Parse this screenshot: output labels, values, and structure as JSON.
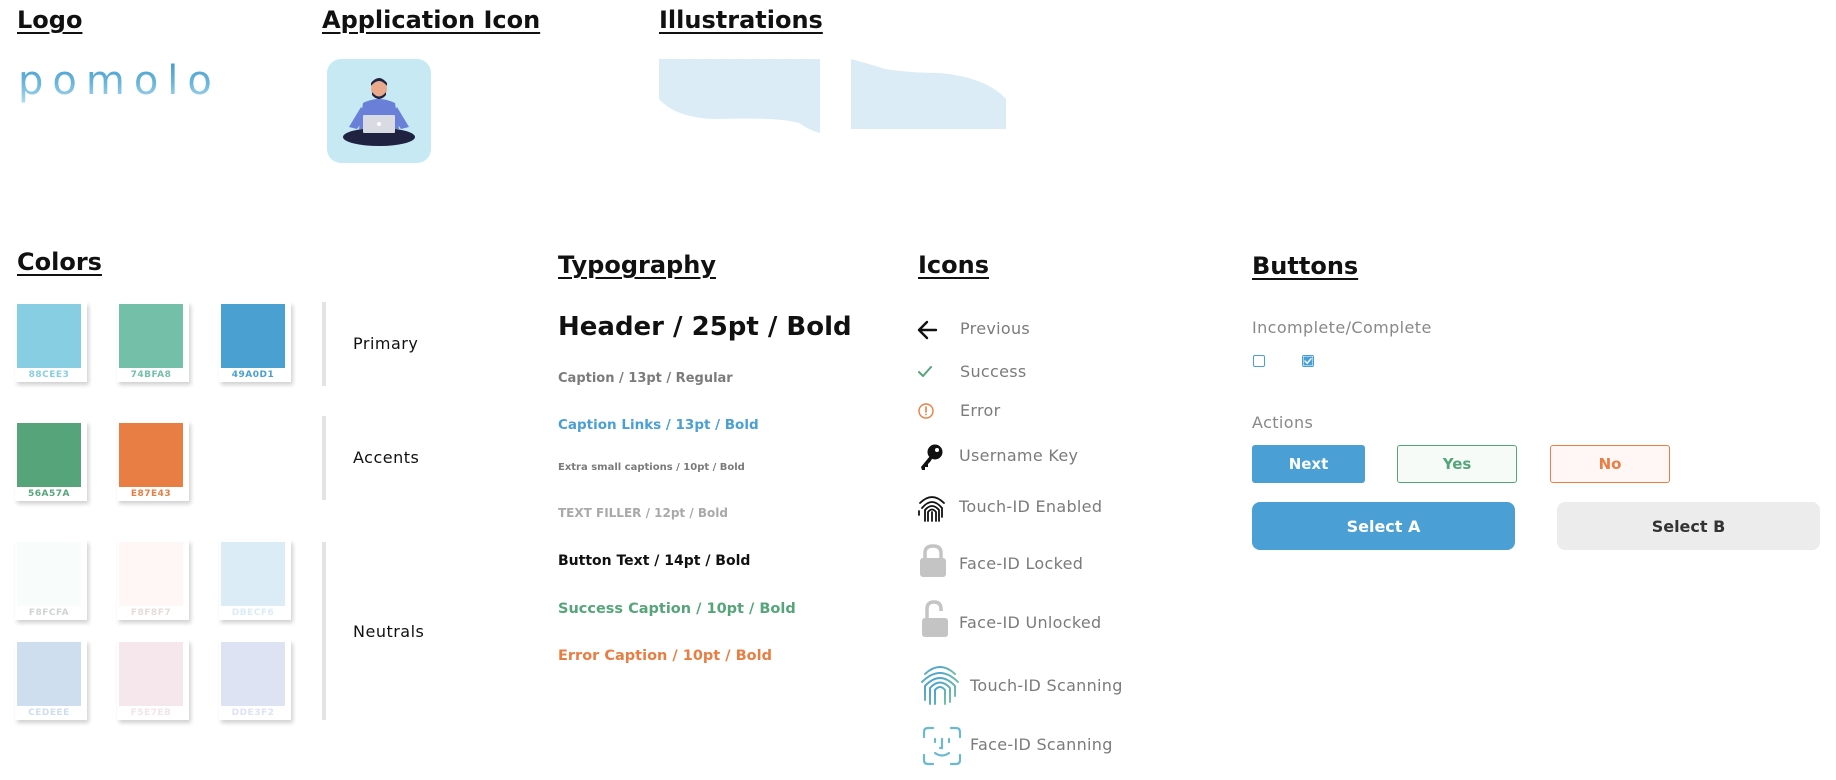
{
  "sections": {
    "logo": "Logo",
    "app_icon": "Application Icon",
    "illustrations": "Illustrations",
    "colors": "Colors",
    "typography": "Typography",
    "icons": "Icons",
    "buttons": "Buttons"
  },
  "logo": {
    "text": "pomolo"
  },
  "colors": {
    "groups": [
      {
        "label": "Primary"
      },
      {
        "label": "Accents"
      },
      {
        "label": "Neutrals"
      }
    ],
    "primary": [
      {
        "hex": "88CEE3",
        "color": "#88CEE3",
        "text_color": "#88CEE3"
      },
      {
        "hex": "74BFA8",
        "color": "#74BFA8",
        "text_color": "#74BFA8"
      },
      {
        "hex": "49A0D1",
        "color": "#49A0D1",
        "text_color": "#49A0D1"
      }
    ],
    "accents": [
      {
        "hex": "56A57A",
        "color": "#56A57A",
        "text_color": "#56A57A"
      },
      {
        "hex": "E87E43",
        "color": "#E87E43",
        "text_color": "#E87E43"
      }
    ],
    "neutrals": [
      {
        "hex": "F8FCFA",
        "color": "#F8FCFA",
        "text_color": "#d8dcda"
      },
      {
        "hex": "F8F8F7",
        "color": "#FEF7F5",
        "text_color": "#ece4e2"
      },
      {
        "hex": "DBECF6",
        "color": "#DBECF6",
        "text_color": "#dbecf6"
      },
      {
        "hex": "CEDEEE",
        "color": "#CEDEEE",
        "text_color": "#d6e6f2"
      },
      {
        "hex": "F5E7EB",
        "color": "#F5E7EB",
        "text_color": "#f1e5e8"
      },
      {
        "hex": "DDE3F2",
        "color": "#DDE3F2",
        "text_color": "#dfe4f2"
      }
    ]
  },
  "typography": {
    "header": "Header / 25pt / Bold",
    "caption": "Caption / 13pt / Regular",
    "caption_links": "Caption Links / 13pt / Bold",
    "extra_small": "Extra small captions / 10pt / Bold",
    "text_filler": "TEXT FILLER / 12pt / Bold",
    "button_text": "Button Text / 14pt / Bold",
    "success_caption": "Success Caption / 10pt / Bold",
    "error_caption": "Error Caption / 10pt / Bold"
  },
  "icons": {
    "previous": "Previous",
    "success": "Success",
    "error": "Error",
    "username_key": "Username Key",
    "touch_id_enabled": "Touch-ID Enabled",
    "face_id_locked": "Face-ID Locked",
    "face_id_unlocked": "Face-ID Unlocked",
    "touch_id_scanning": "Touch-ID Scanning",
    "face_id_scanning": "Face-ID Scanning"
  },
  "buttons": {
    "incomplete_complete": "Incomplete/Complete",
    "actions": "Actions",
    "next": "Next",
    "yes": "Yes",
    "no": "No",
    "select_a": "Select A",
    "select_b": "Select B"
  },
  "palette": {
    "blue": "#4a9fd4",
    "green": "#56a57a",
    "orange": "#e87e43",
    "light_blue": "#dbecf6",
    "gray_button": "#ececec"
  }
}
